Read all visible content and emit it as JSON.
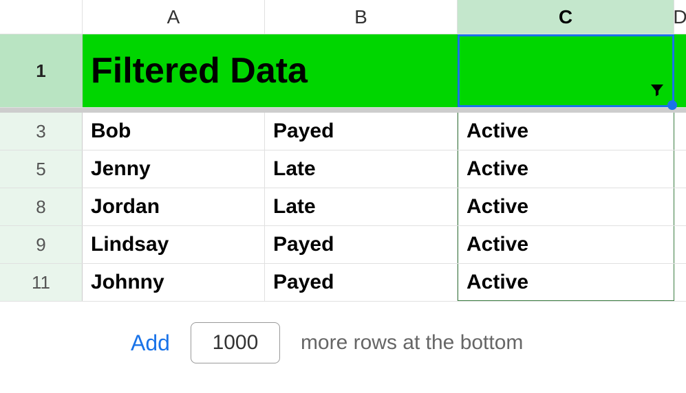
{
  "columns": {
    "a": "A",
    "b": "B",
    "c": "C",
    "d": "D"
  },
  "title_row": {
    "number": "1",
    "title": "Filtered Data"
  },
  "data_rows": [
    {
      "number": "3",
      "a": "Bob",
      "b": "Payed",
      "c": "Active"
    },
    {
      "number": "5",
      "a": "Jenny",
      "b": "Late",
      "c": "Active"
    },
    {
      "number": "8",
      "a": "Jordan",
      "b": "Late",
      "c": "Active"
    },
    {
      "number": "9",
      "a": "Lindsay",
      "b": "Payed",
      "c": "Active"
    },
    {
      "number": "11",
      "a": "Johnny",
      "b": "Payed",
      "c": "Active"
    }
  ],
  "footer": {
    "add_label": "Add",
    "row_count": "1000",
    "more_text": "more rows at the bottom"
  }
}
